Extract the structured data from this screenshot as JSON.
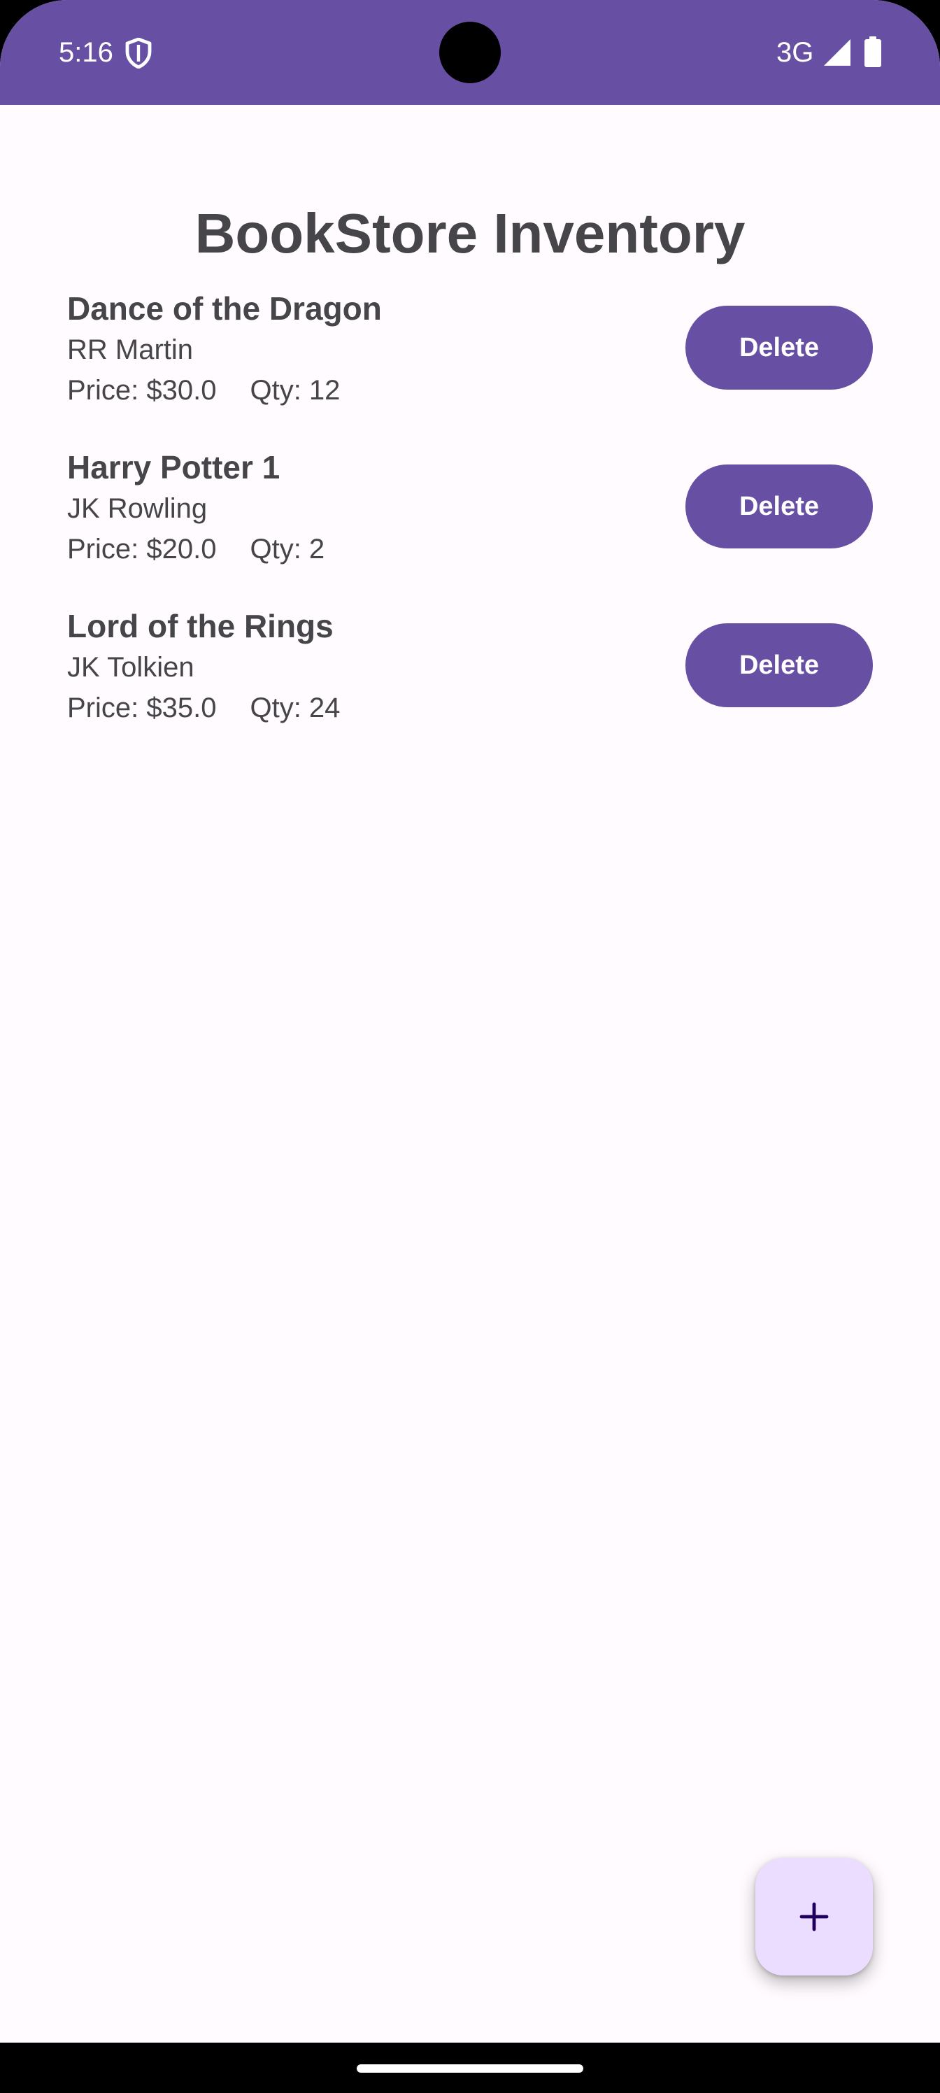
{
  "status_bar": {
    "time": "5:16",
    "network": "3G",
    "icons": [
      "shield-icon",
      "signal-icon",
      "battery-icon"
    ],
    "color": "#6750a4"
  },
  "header": {
    "title": "BookStore Inventory"
  },
  "books": [
    {
      "title": "Dance of the Dragon",
      "author": "RR Martin",
      "price": "Price: $30.0",
      "qty": "Qty: 12",
      "delete_label": "Delete"
    },
    {
      "title": "Harry Potter 1",
      "author": "JK Rowling",
      "price": "Price: $20.0",
      "qty": "Qty: 2",
      "delete_label": "Delete"
    },
    {
      "title": "Lord of the Rings",
      "author": "JK Tolkien",
      "price": "Price: $35.0",
      "qty": "Qty: 24",
      "delete_label": "Delete"
    }
  ],
  "fab": {
    "icon": "plus-icon",
    "color": "#eaddff"
  },
  "theme": {
    "primary": "#6750a4",
    "background": "#fffbfe",
    "text": "#45454a"
  }
}
